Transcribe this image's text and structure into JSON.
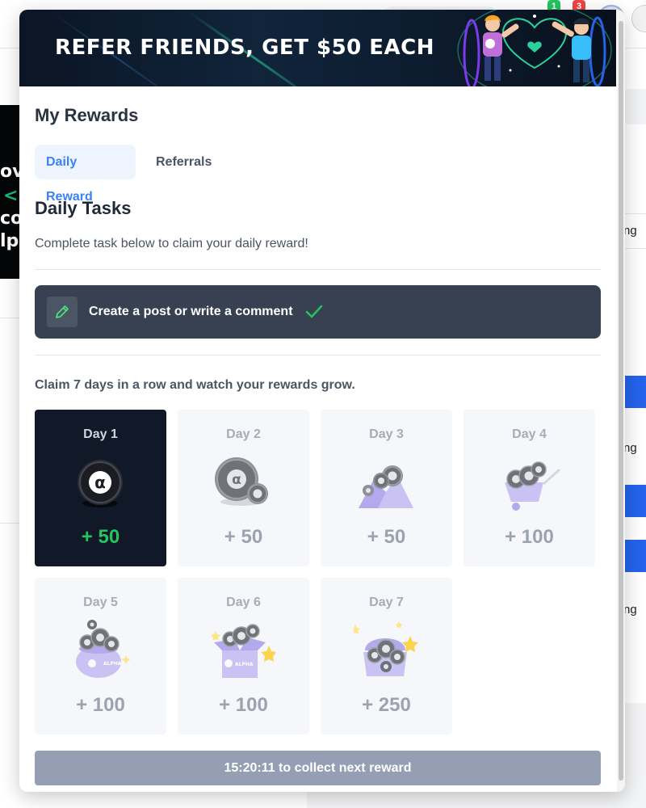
{
  "background": {
    "badges": [
      "1",
      "3"
    ],
    "left_ad_lines": [
      "ov",
      "co",
      "lp"
    ],
    "right_items": [
      "ng",
      "ng",
      "ng"
    ]
  },
  "banner": {
    "title": "REFER FRIENDS, GET $50 EACH"
  },
  "rewards": {
    "title": "My Rewards",
    "tabs": [
      {
        "label": "Daily Reward",
        "active": true
      },
      {
        "label": "Referrals",
        "active": false
      }
    ],
    "section_title": "Daily Tasks",
    "subtitle": "Complete task below to claim your daily reward!",
    "task": {
      "label": "Create a post or write a comment",
      "icon": "pencil-icon",
      "completed": true,
      "check_icon": "check-icon"
    },
    "streak_text": "Claim 7 days in a row and watch your rewards grow.",
    "days": [
      {
        "label": "Day 1",
        "value": "+ 50",
        "icon": "single-coin-icon",
        "active": true
      },
      {
        "label": "Day 2",
        "value": "+ 50",
        "icon": "two-coins-icon",
        "active": false
      },
      {
        "label": "Day 3",
        "value": "+ 50",
        "icon": "coin-pile-icon",
        "active": false
      },
      {
        "label": "Day 4",
        "value": "+ 100",
        "icon": "wheelbarrow-coins-icon",
        "active": false
      },
      {
        "label": "Day 5",
        "value": "+ 100",
        "icon": "coin-pot-icon",
        "active": false
      },
      {
        "label": "Day 6",
        "value": "+ 100",
        "icon": "coin-box-icon",
        "active": false
      },
      {
        "label": "Day 7",
        "value": "+ 250",
        "icon": "treasure-chest-icon",
        "active": false
      }
    ],
    "collect_button": "15:20:11 to collect next reward"
  },
  "colors": {
    "accent": "#3b82f6",
    "success": "#22c55e",
    "dark": "#111827",
    "task_bg": "#374151",
    "button_disabled": "#959fb4"
  }
}
